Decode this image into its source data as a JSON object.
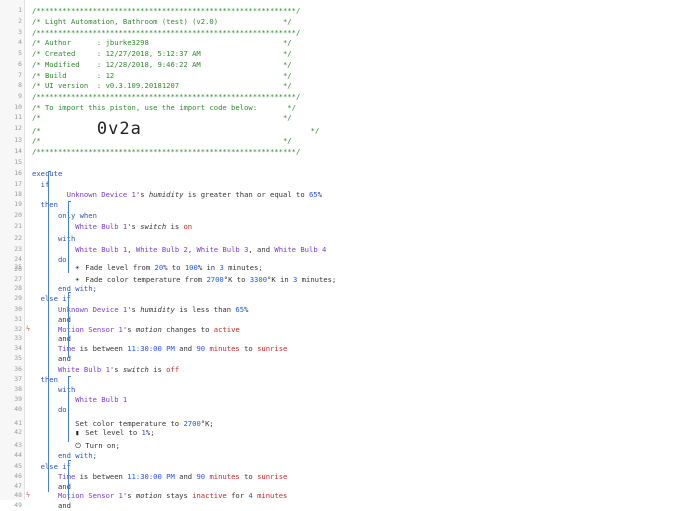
{
  "lines": [
    {
      "n": "1",
      "t": [
        [
          "cmt",
          "/************************************************************/"
        ]
      ]
    },
    {
      "n": "2",
      "t": [
        [
          "cmt",
          "/* Light Automation, Bathroom (test) (v2.0)               */"
        ]
      ]
    },
    {
      "n": "3",
      "t": [
        [
          "cmt",
          "/************************************************************/"
        ]
      ]
    },
    {
      "n": "4",
      "t": [
        [
          "cmt",
          "/* Author      : jburke3298                               */"
        ]
      ]
    },
    {
      "n": "5",
      "t": [
        [
          "cmt",
          "/* Created     : 12/27/2018, 5:12:37 AM                   */"
        ]
      ]
    },
    {
      "n": "6",
      "t": [
        [
          "cmt",
          "/* Modified    : 12/28/2018, 9:46:22 AM                   */"
        ]
      ]
    },
    {
      "n": "7",
      "t": [
        [
          "cmt",
          "/* Build       : 12                                       */"
        ]
      ]
    },
    {
      "n": "8",
      "t": [
        [
          "cmt",
          "/* UI version  : v0.3.109.20181207                        */"
        ]
      ]
    },
    {
      "n": "9",
      "t": [
        [
          "cmt",
          "/************************************************************/"
        ]
      ]
    },
    {
      "n": "10",
      "t": [
        [
          "cmt",
          "/* To import this piston, use the import code below:       */"
        ]
      ]
    },
    {
      "n": "11",
      "t": [
        [
          "cmt",
          "/*                                                        */"
        ]
      ]
    },
    {
      "n": "12",
      "t": [
        [
          "cmt",
          "/*             "
        ],
        [
          "big",
          "0v2a"
        ],
        [
          "cmt",
          "                                       */"
        ]
      ]
    },
    {
      "n": "13",
      "t": [
        [
          "cmt",
          "/*                                                        */"
        ]
      ]
    },
    {
      "n": "14",
      "t": [
        [
          "cmt",
          "/************************************************************/"
        ]
      ]
    },
    {
      "n": "15",
      "t": []
    },
    {
      "n": "16",
      "t": [
        [
          "kw",
          "execute"
        ]
      ]
    },
    {
      "n": "17",
      "t": [
        [
          "op",
          "  "
        ],
        [
          "kw",
          "if"
        ]
      ]
    },
    {
      "n": "18",
      "t": [
        [
          "op",
          "        "
        ],
        [
          "dev",
          "Unknown Device 1"
        ],
        [
          "op",
          "'s "
        ],
        [
          "em",
          "humidity"
        ],
        [
          "op",
          " is greater than or equal to "
        ],
        [
          "val",
          "65"
        ],
        [
          "op",
          "%"
        ]
      ]
    },
    {
      "n": "19",
      "t": [
        [
          "op",
          "  "
        ],
        [
          "kw",
          "then"
        ]
      ]
    },
    {
      "n": "20",
      "t": [
        [
          "op",
          "      "
        ],
        [
          "kw",
          "only when"
        ]
      ]
    },
    {
      "n": "21",
      "t": [
        [
          "op",
          "          "
        ],
        [
          "dev",
          "White Bulb 1"
        ],
        [
          "op",
          "'s "
        ],
        [
          "em",
          "switch"
        ],
        [
          "op",
          " is "
        ],
        [
          "str",
          "on"
        ]
      ]
    },
    {
      "n": "22",
      "t": [
        [
          "op",
          "      "
        ],
        [
          "kw",
          "with"
        ]
      ]
    },
    {
      "n": "23",
      "t": [
        [
          "op",
          "          "
        ],
        [
          "dev",
          "White Bulb 1"
        ],
        [
          "op",
          ", "
        ],
        [
          "dev",
          "White Bulb 2"
        ],
        [
          "op",
          ", "
        ],
        [
          "dev",
          "White Bulb 3"
        ],
        [
          "op",
          ", and "
        ],
        [
          "dev",
          "White Bulb 4"
        ]
      ]
    },
    {
      "n": "24",
      "t": [
        [
          "op",
          "      "
        ],
        [
          "kw",
          "do"
        ]
      ]
    },
    {
      "n": "25",
      "t": [
        [
          "op",
          "          "
        ],
        [
          "ico",
          "☀"
        ],
        [
          "op",
          "Fade level from "
        ],
        [
          "val",
          "20"
        ],
        [
          "op",
          "% to "
        ],
        [
          "val",
          "100"
        ],
        [
          "op",
          "% in "
        ],
        [
          "val",
          "3"
        ],
        [
          "op",
          " minutes;"
        ]
      ]
    },
    {
      "n": "26",
      "t": []
    },
    {
      "n": "27",
      "t": [
        [
          "op",
          "          "
        ],
        [
          "ico",
          "☀"
        ],
        [
          "op",
          "Fade color temperature from "
        ],
        [
          "val",
          "2700"
        ],
        [
          "op",
          "°K to "
        ],
        [
          "val",
          "3300"
        ],
        [
          "op",
          "°K in "
        ],
        [
          "val",
          "3"
        ],
        [
          "op",
          " minutes;"
        ]
      ]
    },
    {
      "n": "28",
      "t": [
        [
          "op",
          "      "
        ],
        [
          "kw",
          "end with;"
        ]
      ]
    },
    {
      "n": "29",
      "t": [
        [
          "op",
          "  "
        ],
        [
          "kw",
          "else if"
        ]
      ]
    },
    {
      "n": "30",
      "t": [
        [
          "op",
          "      "
        ],
        [
          "dev",
          "Unknown Device 1"
        ],
        [
          "op",
          "'s "
        ],
        [
          "em",
          "humidity"
        ],
        [
          "op",
          " is less than "
        ],
        [
          "val",
          "65"
        ],
        [
          "op",
          "%"
        ]
      ]
    },
    {
      "n": "31",
      "t": [
        [
          "op",
          "      and"
        ]
      ]
    },
    {
      "n": "32",
      "flag": "ϟ",
      "t": [
        [
          "op",
          "      "
        ],
        [
          "dev",
          "Motion Sensor 1"
        ],
        [
          "op",
          "'s "
        ],
        [
          "em",
          "motion"
        ],
        [
          "op",
          " changes to "
        ],
        [
          "str",
          "active"
        ]
      ]
    },
    {
      "n": "33",
      "t": [
        [
          "op",
          "      and"
        ]
      ]
    },
    {
      "n": "34",
      "t": [
        [
          "op",
          "      "
        ],
        [
          "dev",
          "Time"
        ],
        [
          "op",
          " is between "
        ],
        [
          "val",
          "11:30:00 PM"
        ],
        [
          "op",
          " and "
        ],
        [
          "val",
          "90"
        ],
        [
          "op",
          " "
        ],
        [
          "str",
          "minutes"
        ],
        [
          "op",
          " to "
        ],
        [
          "str",
          "sunrise"
        ]
      ]
    },
    {
      "n": "35",
      "t": [
        [
          "op",
          "      and"
        ]
      ]
    },
    {
      "n": "36",
      "t": [
        [
          "op",
          "      "
        ],
        [
          "dev",
          "White Bulb 1"
        ],
        [
          "op",
          "'s "
        ],
        [
          "em",
          "switch"
        ],
        [
          "op",
          " is "
        ],
        [
          "str",
          "off"
        ]
      ]
    },
    {
      "n": "37",
      "t": [
        [
          "op",
          "  "
        ],
        [
          "kw",
          "then"
        ]
      ]
    },
    {
      "n": "38",
      "t": [
        [
          "op",
          "      "
        ],
        [
          "kw",
          "with"
        ]
      ]
    },
    {
      "n": "39",
      "t": [
        [
          "op",
          "          "
        ],
        [
          "dev",
          "White Bulb 1"
        ]
      ]
    },
    {
      "n": "40",
      "t": [
        [
          "op",
          "      "
        ],
        [
          "kw",
          "do"
        ]
      ]
    },
    {
      "n": "41",
      "t": [
        [
          "op",
          "          Set color temperature to "
        ],
        [
          "val",
          "2700"
        ],
        [
          "op",
          "°K;"
        ]
      ]
    },
    {
      "n": "42",
      "t": [
        [
          "op",
          "          "
        ],
        [
          "ico",
          "▮"
        ],
        [
          "op",
          "Set level to "
        ],
        [
          "val",
          "1"
        ],
        [
          "op",
          "%;"
        ]
      ]
    },
    {
      "n": "43",
      "t": [
        [
          "op",
          "          "
        ],
        [
          "ico",
          "⏻"
        ],
        [
          "op",
          "Turn on;"
        ]
      ]
    },
    {
      "n": "44",
      "t": [
        [
          "op",
          "      "
        ],
        [
          "kw",
          "end with;"
        ]
      ]
    },
    {
      "n": "45",
      "t": [
        [
          "op",
          "  "
        ],
        [
          "kw",
          "else if"
        ]
      ]
    },
    {
      "n": "46",
      "t": [
        [
          "op",
          "      "
        ],
        [
          "dev",
          "Time"
        ],
        [
          "op",
          " is between "
        ],
        [
          "val",
          "11:30:00 PM"
        ],
        [
          "op",
          " and "
        ],
        [
          "val",
          "90"
        ],
        [
          "op",
          " "
        ],
        [
          "str",
          "minutes"
        ],
        [
          "op",
          " to "
        ],
        [
          "str",
          "sunrise"
        ]
      ]
    },
    {
      "n": "47",
      "t": [
        [
          "op",
          "      and"
        ]
      ]
    },
    {
      "n": "48",
      "flag": "ϟ",
      "t": [
        [
          "op",
          "      "
        ],
        [
          "dev",
          "Motion Sensor 1"
        ],
        [
          "op",
          "'s "
        ],
        [
          "em",
          "motion"
        ],
        [
          "op",
          " stays "
        ],
        [
          "str",
          "inactive"
        ],
        [
          "op",
          " for "
        ],
        [
          "val",
          "4"
        ],
        [
          "op",
          " "
        ],
        [
          "str",
          "minutes"
        ]
      ]
    },
    {
      "n": "49",
      "t": [
        [
          "op",
          "      and"
        ]
      ]
    }
  ]
}
